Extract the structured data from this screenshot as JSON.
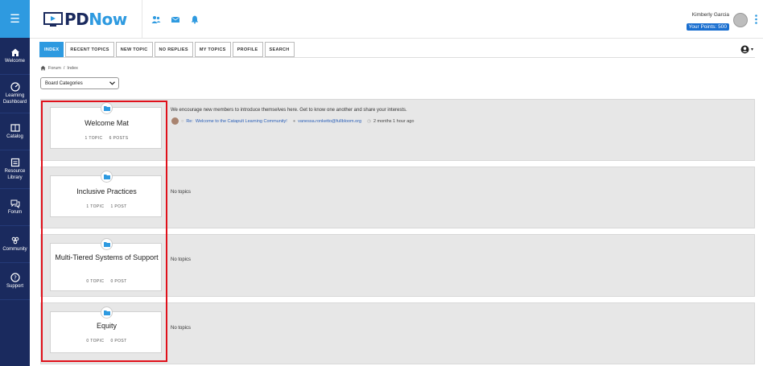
{
  "sidebar": {
    "menu_icon": "hamburger-icon",
    "items": [
      {
        "label": "Welcome",
        "icon": "home-icon"
      },
      {
        "label": "Learning Dashboard",
        "icon": "dashboard-icon"
      },
      {
        "label": "Catalog",
        "icon": "book-icon"
      },
      {
        "label": "Resource Library",
        "icon": "library-icon"
      },
      {
        "label": "Forum",
        "icon": "forum-icon"
      },
      {
        "label": "Community",
        "icon": "community-icon"
      },
      {
        "label": "Support",
        "icon": "help-icon"
      }
    ]
  },
  "header": {
    "logo_pd": "PD",
    "logo_now": "Now",
    "user_name": "Kimberly Garcia",
    "points": "Your Points: 500"
  },
  "tabs": [
    "INDEX",
    "RECENT TOPICS",
    "NEW TOPIC",
    "NO REPLIES",
    "MY TOPICS",
    "PROFILE",
    "SEARCH"
  ],
  "breadcrumb": {
    "home": "Forum",
    "current": "Index"
  },
  "board_select": {
    "value": "Board Categories"
  },
  "boards": [
    {
      "title": "Welcome Mat",
      "topics": "1 TOPIC",
      "posts": "6 POSTS",
      "description": "We encourage new members to introduce themselves here. Get to know one another and share your interests.",
      "last_post": {
        "prefix": "Re:",
        "title": "Welcome to the Catapult Learning Community!",
        "author": "vanessa.ronketto@fullbloom.org",
        "time": "2 months 1 hour ago"
      }
    },
    {
      "title": "Inclusive Practices",
      "topics": "1 TOPIC",
      "posts": "1 POST",
      "status": "No topics"
    },
    {
      "title": "Multi-Tiered Systems of Support",
      "topics": "0 TOPIC",
      "posts": "0 POST",
      "status": "No topics"
    },
    {
      "title": "Equity",
      "topics": "0 TOPIC",
      "posts": "0 POST",
      "status": "No topics"
    }
  ],
  "colors": {
    "sidebar": "#1a2a5e",
    "accent": "#2e9ae0",
    "highlight": "#e0101a"
  }
}
